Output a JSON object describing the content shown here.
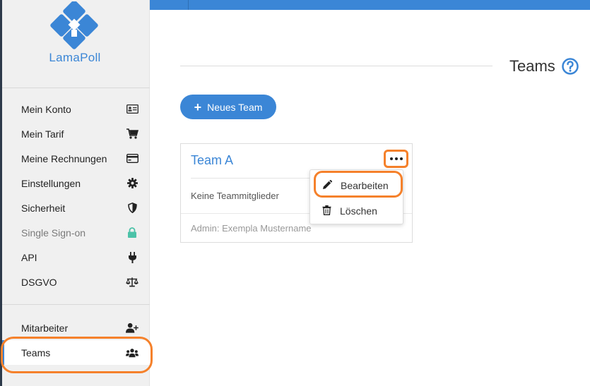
{
  "app": {
    "logo_text": "LamaPoll"
  },
  "colors": {
    "accent": "#3b86d6",
    "highlight": "#f5812b",
    "success": "#4cc2a8"
  },
  "sidebar": {
    "items": [
      {
        "label": "Mein Konto",
        "icon": "id-card-icon"
      },
      {
        "label": "Mein Tarif",
        "icon": "cart-icon"
      },
      {
        "label": "Meine Rechnungen",
        "icon": "credit-card-icon"
      },
      {
        "label": "Einstellungen",
        "icon": "gear-icon"
      },
      {
        "label": "Sicherheit",
        "icon": "shield-icon"
      },
      {
        "label": "Single Sign-on",
        "icon": "lock-icon"
      },
      {
        "label": "API",
        "icon": "plug-icon"
      },
      {
        "label": "DSGVO",
        "icon": "scale-icon"
      }
    ],
    "team_items": [
      {
        "label": "Mitarbeiter",
        "icon": "user-plus-icon"
      },
      {
        "label": "Teams",
        "icon": "users-icon"
      }
    ]
  },
  "main": {
    "page_title": "Teams",
    "new_team_label": "Neues Team",
    "team_card": {
      "name": "Team A",
      "members_text": "Keine Teammitglieder",
      "admin_text": "Admin: Exempla Mustername"
    },
    "dropdown": {
      "edit_label": "Bearbeiten",
      "delete_label": "Löschen"
    }
  }
}
